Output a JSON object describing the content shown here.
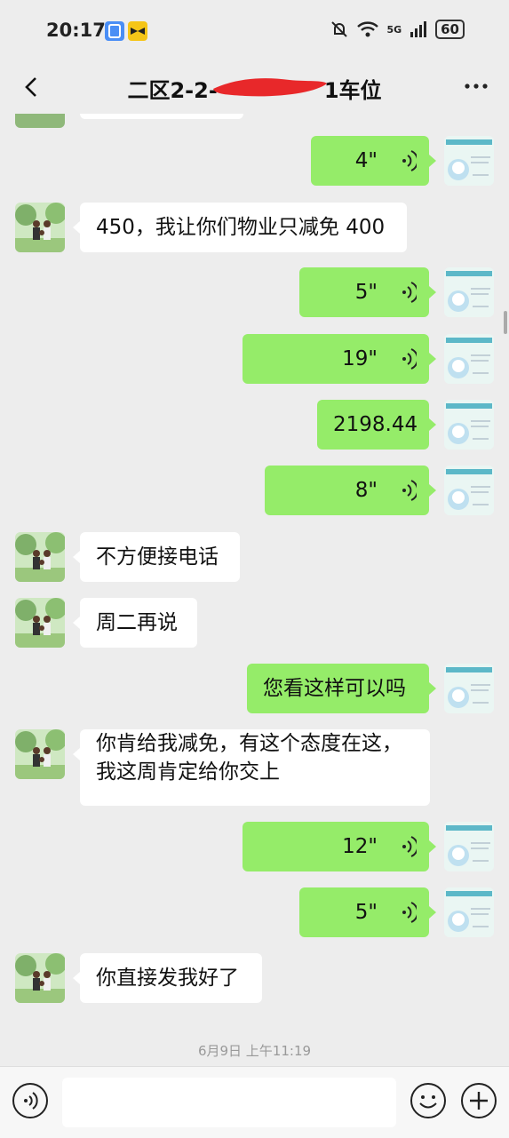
{
  "status_bar": {
    "time": "20:17",
    "network": "5G",
    "battery": "60",
    "icons": [
      "app-notification-icon",
      "bowtie-app-icon",
      "mute-bell-icon",
      "wifi-icon",
      "signal-icon",
      "battery-icon"
    ]
  },
  "header": {
    "title": "二区2-2-",
    "title_suffix": "1车位"
  },
  "messages": [
    {
      "side": "out",
      "type": "voice",
      "text": "4\""
    },
    {
      "side": "in",
      "type": "text",
      "text": "450，我让你们物业只减免 400"
    },
    {
      "side": "out",
      "type": "voice",
      "text": "5\""
    },
    {
      "side": "out",
      "type": "voice",
      "text": "19\""
    },
    {
      "side": "out",
      "type": "text",
      "text": "2198.44"
    },
    {
      "side": "out",
      "type": "voice",
      "text": "8\""
    },
    {
      "side": "in",
      "type": "text",
      "text": "不方便接电话"
    },
    {
      "side": "in",
      "type": "text",
      "text": "周二再说"
    },
    {
      "side": "out",
      "type": "text",
      "text": "您看这样可以吗"
    },
    {
      "side": "in",
      "type": "text",
      "text": "你肯给我减免，有这个态度在这，",
      "line2": "我这周肯定给你交上"
    },
    {
      "side": "out",
      "type": "voice",
      "text": "12\""
    },
    {
      "side": "out",
      "type": "voice",
      "text": "5\""
    },
    {
      "side": "in",
      "type": "text",
      "text": "你直接发我好了"
    }
  ],
  "timestamp": "6月9日 上午11:19",
  "colors": {
    "background": "#ededed",
    "bubble_out": "#95ec69",
    "bubble_in": "#ffffff",
    "redaction": "#e8282a"
  }
}
